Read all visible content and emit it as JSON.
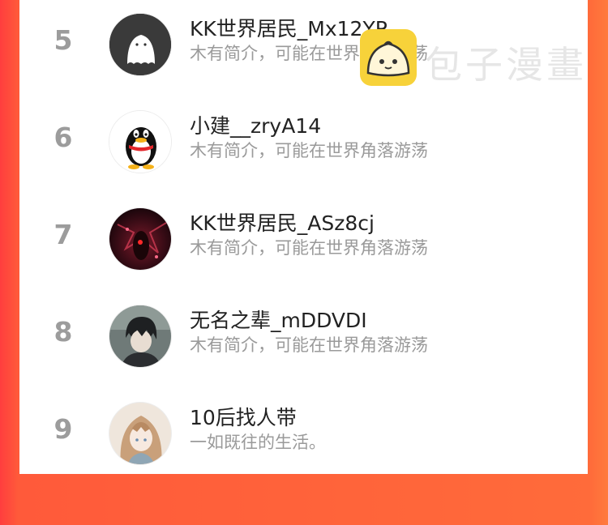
{
  "ranking": [
    {
      "rank": "5",
      "name": "KK世界居民_Mx12YP",
      "bio": "木有简介，可能在世界角落游荡",
      "avatar": "default-ghost-avatar"
    },
    {
      "rank": "6",
      "name": "小建__zryA14",
      "bio": "木有简介，可能在世界角落游荡",
      "avatar": "qq-penguin-avatar"
    },
    {
      "rank": "7",
      "name": "KK世界居民_ASz8cj",
      "bio": "木有简介，可能在世界角落游荡",
      "avatar": "dark-red-art-avatar"
    },
    {
      "rank": "8",
      "name": "无名之辈_mDDVDI",
      "bio": "木有简介，可能在世界角落游荡",
      "avatar": "anime-boy-avatar"
    },
    {
      "rank": "9",
      "name": "10后找人带",
      "bio": "一如既往的生活。",
      "avatar": "anime-girl-avatar"
    }
  ],
  "watermark": {
    "text": "包子漫畫",
    "icon": "bun-logo-icon"
  },
  "colors": {
    "background_left": "#ff3e3e",
    "background_right": "#ff7a3c",
    "rank_text": "#9c9c9c",
    "bio_text": "#9a9a9a",
    "watermark_badge": "#f7d23a"
  }
}
